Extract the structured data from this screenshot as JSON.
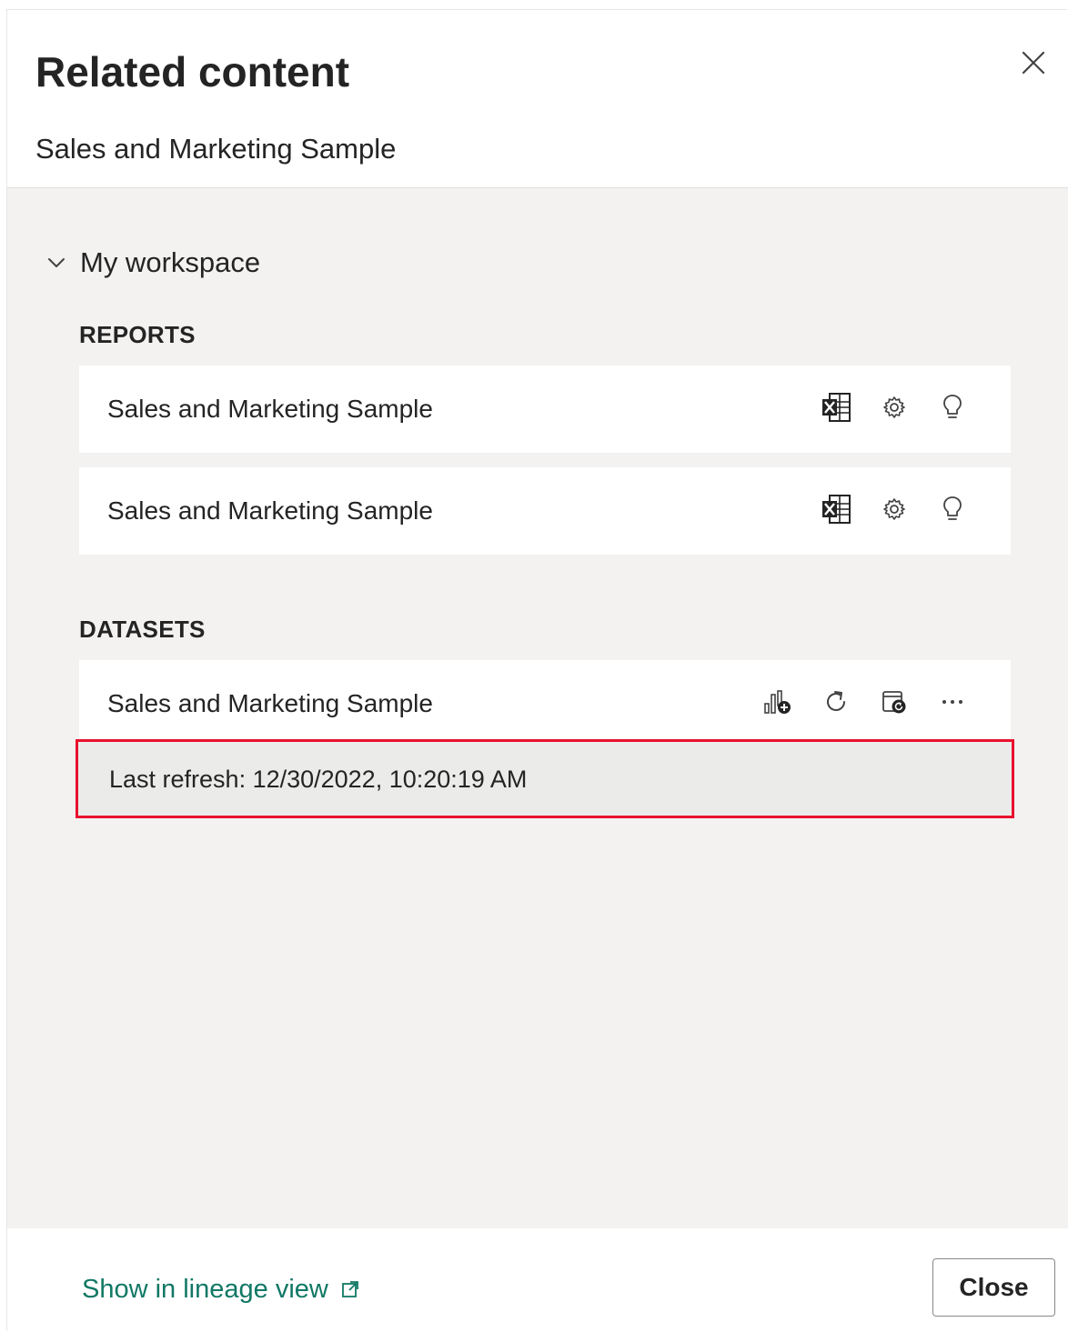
{
  "dialog": {
    "title": "Related content",
    "subtitle": "Sales and Marketing Sample",
    "close_icon": "close-icon"
  },
  "workspace": {
    "label": "My workspace",
    "expanded": true,
    "chevron_icon": "chevron-down-icon"
  },
  "reports": {
    "heading": "REPORTS",
    "items": [
      {
        "name": "Sales and Marketing Sample",
        "actions": [
          "excel-icon",
          "gear-icon",
          "lightbulb-icon"
        ]
      },
      {
        "name": "Sales and Marketing Sample",
        "actions": [
          "excel-icon",
          "gear-icon",
          "lightbulb-icon"
        ]
      }
    ]
  },
  "datasets": {
    "heading": "DATASETS",
    "items": [
      {
        "name": "Sales and Marketing Sample",
        "actions": [
          "create-report-icon",
          "refresh-icon",
          "scheduled-refresh-icon",
          "more-options-icon"
        ],
        "last_refresh": "Last refresh: 12/30/2022, 10:20:19 AM"
      }
    ]
  },
  "footer": {
    "lineage_link": "Show in lineage view",
    "lineage_icon": "open-external-icon",
    "close_button": "Close"
  },
  "colors": {
    "link": "#117865",
    "body_background": "#f3f2f1",
    "highlight_border": "#e8112d"
  }
}
